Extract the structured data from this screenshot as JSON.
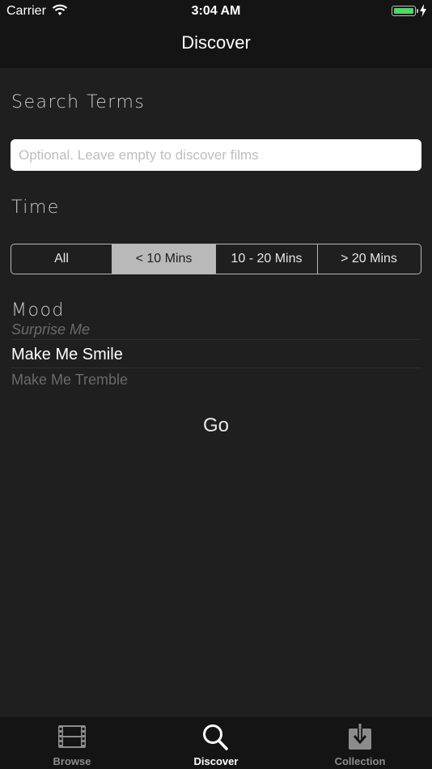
{
  "status_bar": {
    "carrier": "Carrier",
    "time": "3:04 AM",
    "battery_color": "#4cd964"
  },
  "nav": {
    "title": "Discover"
  },
  "search": {
    "label": "Search Terms",
    "placeholder": "Optional. Leave empty to discover films",
    "value": ""
  },
  "time_filter": {
    "label": "Time",
    "options": [
      "All",
      "< 10 Mins",
      "10 - 20 Mins",
      "> 20 Mins"
    ],
    "selected": "< 10 Mins"
  },
  "mood": {
    "label": "Mood",
    "options": [
      "Surprise Me",
      "Make Me Smile",
      "Make Me Tremble"
    ],
    "selected": "Make Me Smile"
  },
  "go_label": "Go",
  "tabs": [
    {
      "label": "Browse",
      "icon": "film-icon",
      "active": false
    },
    {
      "label": "Discover",
      "icon": "search-icon",
      "active": true
    },
    {
      "label": "Collection",
      "icon": "download-icon",
      "active": false
    }
  ]
}
